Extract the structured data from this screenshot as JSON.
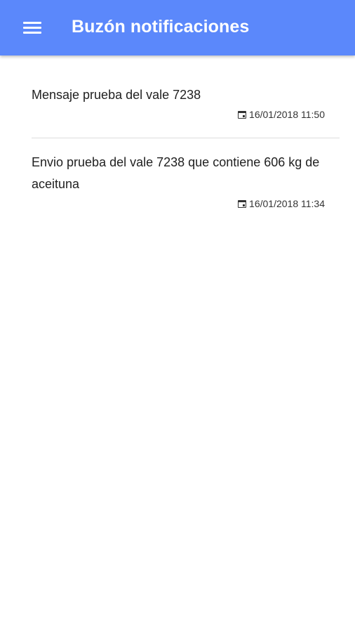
{
  "appbar": {
    "title": "Buzón notificaciones",
    "color": "#5b88fb",
    "menu_icon": "hamburger-menu-icon"
  },
  "notifications": [
    {
      "message": "Mensaje prueba del vale 7238",
      "datetime": "16/01/2018 11:50",
      "icon": "calendar-icon"
    },
    {
      "message": "Envio prueba del vale 7238 que contiene 606 kg de aceituna",
      "datetime": "16/01/2018 11:34",
      "icon": "calendar-icon"
    }
  ]
}
